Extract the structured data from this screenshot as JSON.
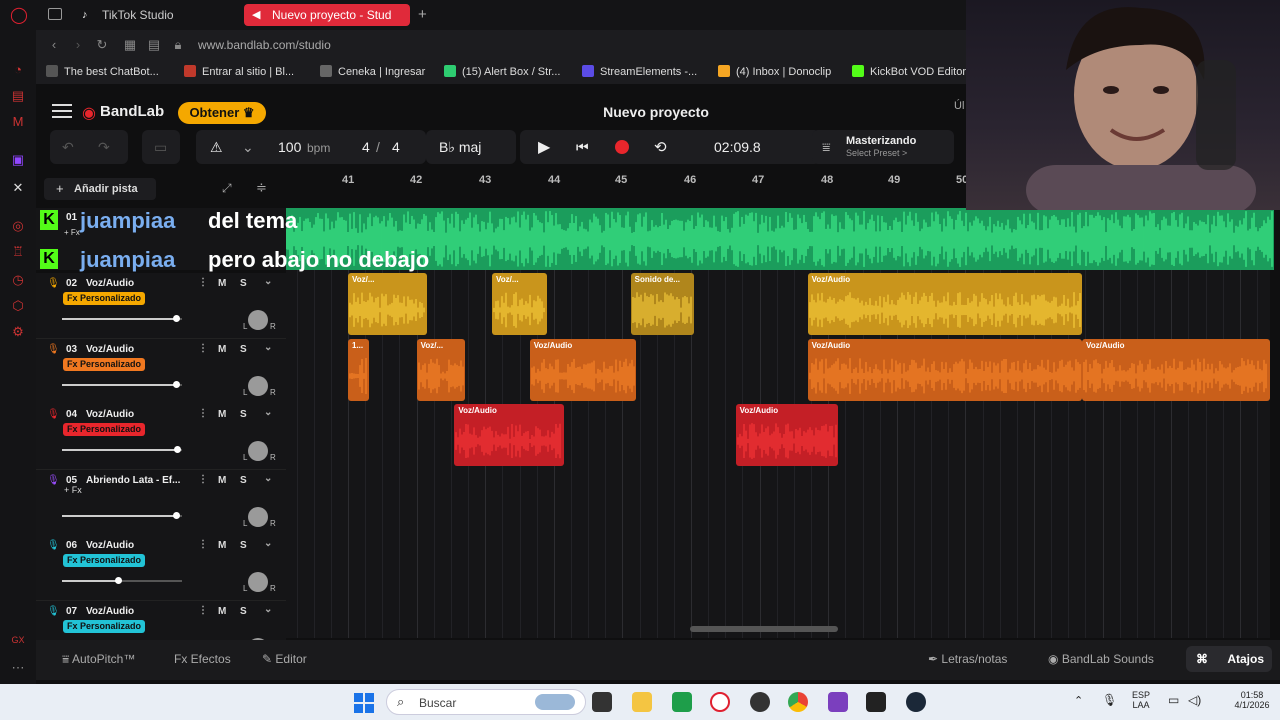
{
  "browser": {
    "tabs": [
      {
        "label": "TikTok Studio",
        "active": false
      },
      {
        "label": "Nuevo proyecto - Stud",
        "active": true
      }
    ],
    "url": "www.bandlab.com/studio",
    "bookmarks": [
      {
        "label": "The best ChatBot...",
        "color": "#444"
      },
      {
        "label": "Entrar al sitio | Bl...",
        "color": "#c0392b"
      },
      {
        "label": "Ceneka | Ingresar",
        "color": "#444"
      },
      {
        "label": "(15) Alert Box / Str...",
        "color": "#2ecc71"
      },
      {
        "label": "StreamElements -...",
        "color": "#5b4ce6"
      },
      {
        "label": "(4) Inbox | Donoclip",
        "color": "#f5a623"
      },
      {
        "label": "KickBot VOD Editor",
        "color": "#53fc18"
      }
    ]
  },
  "header": {
    "logo": "BandLab",
    "obtener_label": "Obtener",
    "project_title": "Nuevo proyecto",
    "ul_fragment": "Úl"
  },
  "transport": {
    "bpm_value": "100",
    "bpm_unit": "bpm",
    "time_sig_num": "4",
    "time_sig_sep": "/",
    "time_sig_den": "4",
    "key": "B♭ maj",
    "time": "02:09.8",
    "mastering_title": "Masterizando",
    "mastering_sub": "Select Preset >"
  },
  "add_track_label": "Añadir pista",
  "ruler": [
    "41",
    "42",
    "43",
    "44",
    "45",
    "46",
    "47",
    "48",
    "49",
    "50"
  ],
  "overlay": [
    {
      "user": "juampiaa",
      "message": "del tema"
    },
    {
      "user": "juampiaa",
      "message": "pero abajo no debajo"
    }
  ],
  "track1": {
    "number": "01",
    "fx": "+ Fx"
  },
  "tracks": [
    {
      "number": "02",
      "name": "Voz/Audio",
      "fx": "Fx Personalizado",
      "fx_color": "#f5a800",
      "color": "#e0a820",
      "icon_color": "#f5a800",
      "volume": 0.95
    },
    {
      "number": "03",
      "name": "Voz/Audio",
      "fx": "Fx Personalizado",
      "fx_color": "#f07820",
      "color": "#e06a1c",
      "icon_color": "#f07820",
      "volume": 0.95
    },
    {
      "number": "04",
      "name": "Voz/Audio",
      "fx": "Fx Personalizado",
      "fx_color": "#e8262c",
      "color": "#d4202a",
      "icon_color": "#e8262c",
      "volume": 0.96
    },
    {
      "number": "05",
      "name": "Abriendo Lata - Ef...",
      "fx": "+ Fx",
      "fx_color": "",
      "color": "#8a2be2",
      "icon_color": "#9b4dff",
      "volume": 0.95
    },
    {
      "number": "06",
      "name": "Voz/Audio",
      "fx": "Fx Personalizado",
      "fx_color": "#22c3d6",
      "color": "#22c3d6",
      "icon_color": "#22c3d6",
      "volume": 0.47
    },
    {
      "number": "07",
      "name": "Voz/Audio",
      "fx": "Fx Personalizado",
      "fx_color": "#22c3d6",
      "color": "#22c3d6",
      "icon_color": "#22c3d6",
      "volume": 0.5
    }
  ],
  "track_buttons": {
    "mute": "M",
    "solo": "S"
  },
  "knob_labels": {
    "left": "L",
    "right": "R"
  },
  "clips": [
    {
      "track": 0,
      "label": "Voz/...",
      "start": 41.0,
      "end": 42.15,
      "color": "#c9951c"
    },
    {
      "track": 0,
      "label": "Voz/...",
      "start": 43.1,
      "end": 43.9,
      "color": "#c9951c"
    },
    {
      "track": 0,
      "label": "Sonido de...",
      "start": 45.12,
      "end": 46.05,
      "color": "#b0861c"
    },
    {
      "track": 0,
      "label": "Voz/Audio",
      "start": 47.7,
      "end": 51.7,
      "color": "#c9951c"
    },
    {
      "track": 1,
      "label": "1...",
      "start": 41.0,
      "end": 41.3,
      "color": "#c95f1a"
    },
    {
      "track": 1,
      "label": "Voz/...",
      "start": 42.0,
      "end": 42.7,
      "color": "#c95f1a"
    },
    {
      "track": 1,
      "label": "Voz/Audio",
      "start": 43.65,
      "end": 45.2,
      "color": "#c95f1a"
    },
    {
      "track": 1,
      "label": "Voz/Audio",
      "start": 47.7,
      "end": 51.7,
      "color": "#c95f1a"
    },
    {
      "track": 1,
      "label": "Voz/Audio",
      "start": 51.7,
      "end": 55.6,
      "color": "#c95f1a"
    },
    {
      "track": 2,
      "label": "Voz/Audio",
      "start": 42.55,
      "end": 44.15,
      "color": "#c41f26"
    },
    {
      "track": 2,
      "label": "Voz/Audio",
      "start": 46.65,
      "end": 48.15,
      "color": "#c41f26"
    }
  ],
  "bottom": {
    "autopitch": "AutoPitch™",
    "efectos": "Efectos",
    "editor": "Editor",
    "letras": "Letras/notas",
    "sounds": "BandLab Sounds",
    "atajos": "Atajos"
  },
  "taskbar": {
    "search_placeholder": "Buscar",
    "lang1": "ESP",
    "lang2": "LAA",
    "time": "01:58",
    "date": "4/1/2026"
  }
}
